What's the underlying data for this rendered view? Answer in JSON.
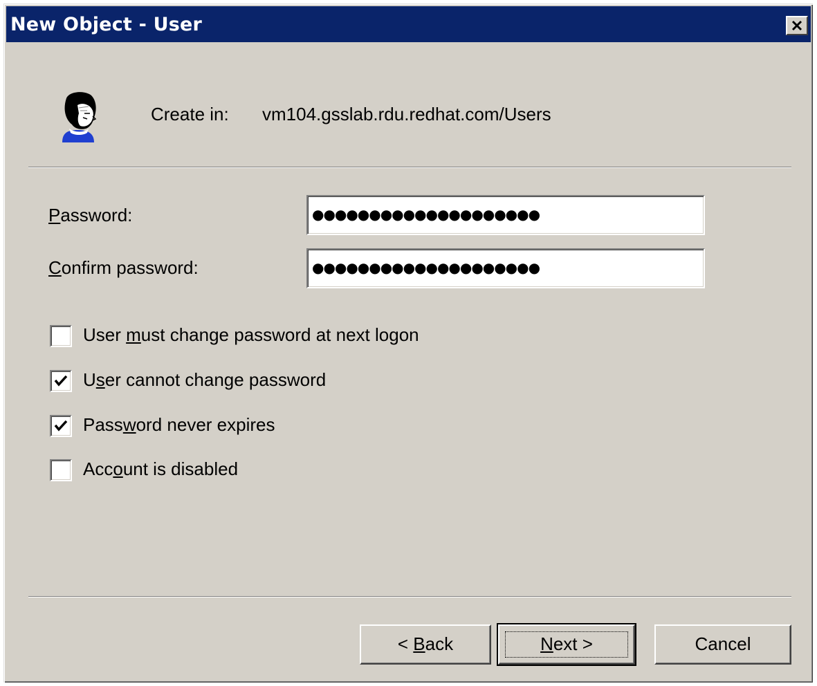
{
  "window": {
    "title": "New Object - User",
    "close_icon": "close-icon"
  },
  "header": {
    "icon": "user-icon",
    "create_in_label": "Create in:",
    "create_in_value": "vm104.gsslab.rdu.redhat.com/Users"
  },
  "form": {
    "password": {
      "label_mnemonic": "P",
      "label_rest": "assword:",
      "value": "●●●●●●●●●●●●●●●●●●●●"
    },
    "confirm": {
      "label_mnemonic": "C",
      "label_rest": "onfirm password:",
      "value": "●●●●●●●●●●●●●●●●●●●●"
    }
  },
  "options": [
    {
      "pre": "User ",
      "mn": "m",
      "post": "ust change password at next logon",
      "checked": false
    },
    {
      "pre": "U",
      "mn": "s",
      "post": "er cannot change password",
      "checked": true
    },
    {
      "pre": "Pass",
      "mn": "w",
      "post": "ord never expires",
      "checked": true
    },
    {
      "pre": "Acc",
      "mn": "o",
      "post": "unt is disabled",
      "checked": false
    }
  ],
  "buttons": {
    "back": {
      "pre": "< ",
      "mn": "B",
      "post": "ack"
    },
    "next": {
      "pre": "",
      "mn": "N",
      "post": "ext >"
    },
    "cancel": {
      "label": "Cancel"
    }
  },
  "colors": {
    "titlebar": "#0a246a",
    "face": "#d4d0c8"
  }
}
